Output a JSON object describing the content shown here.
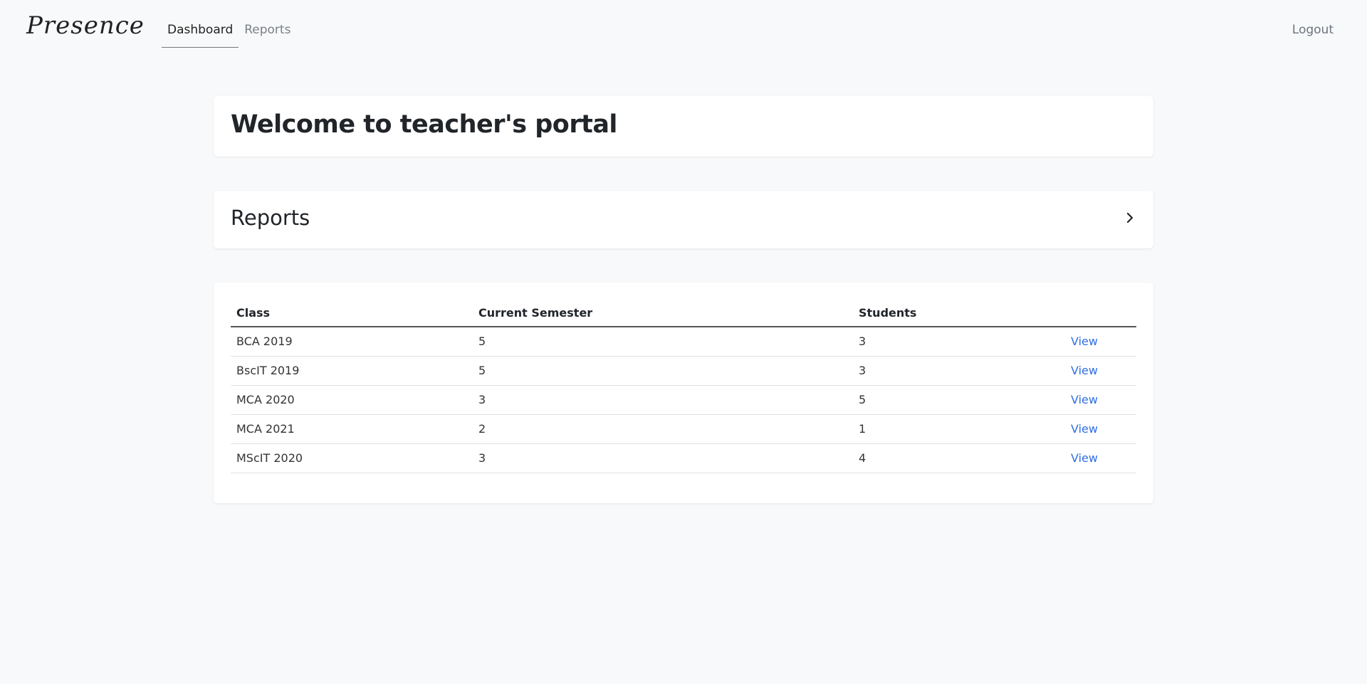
{
  "navbar": {
    "brand": "Presence",
    "links": [
      {
        "label": "Dashboard",
        "active": true
      },
      {
        "label": "Reports",
        "active": false
      }
    ],
    "logout_label": "Logout"
  },
  "welcome": {
    "title": "Welcome to teacher's portal"
  },
  "reports_card": {
    "title": "Reports",
    "icon": "chevron-right-icon"
  },
  "classes_table": {
    "headers": [
      "Class",
      "Current Semester",
      "Students",
      ""
    ],
    "rows": [
      {
        "class": "BCA 2019",
        "semester": "5",
        "students": "3",
        "action": "View"
      },
      {
        "class": "BscIT 2019",
        "semester": "5",
        "students": "3",
        "action": "View"
      },
      {
        "class": "MCA 2020",
        "semester": "3",
        "students": "5",
        "action": "View"
      },
      {
        "class": "MCA 2021",
        "semester": "2",
        "students": "1",
        "action": "View"
      },
      {
        "class": "MScIT 2020",
        "semester": "3",
        "students": "4",
        "action": "View"
      }
    ]
  },
  "colors": {
    "background": "#f8f9fa",
    "card": "#ffffff",
    "link": "#2f6fe4",
    "text": "#212529"
  }
}
